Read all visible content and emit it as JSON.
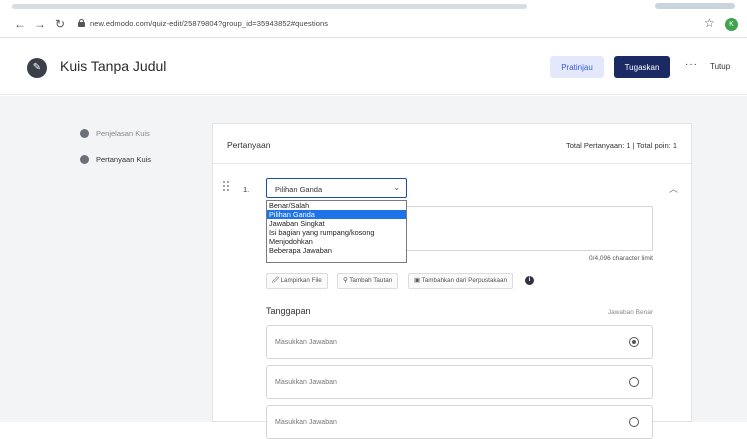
{
  "browser": {
    "back_icon": "back-arrow-icon",
    "forward_icon": "forward-arrow-icon",
    "reload_icon": "reload-icon",
    "url": "new.edmodo.com/quiz-edit/25879804?group_id=35943852#questions",
    "profile_initial": "K"
  },
  "header": {
    "title": "Kuis Tanpa Judul",
    "preview_label": "Pratinjau",
    "assign_label": "Tugaskan",
    "more_label": "···",
    "close_label": "Tutup"
  },
  "sidebar": {
    "items": [
      {
        "label": "Penjelasan Kuis"
      },
      {
        "label": "Pertanyaan Kuis"
      }
    ]
  },
  "panel": {
    "title": "Pertanyaan",
    "totals": "Total Pertanyaan: 1  |  Total poin: 1"
  },
  "question": {
    "number": "1.",
    "type_selected": "Pilihan Ganda",
    "type_options": [
      "Benar/Salah",
      "Pilihan Ganda",
      "Jawaban Singkat",
      "Isi bagian yang rumpang/kosong",
      "Menjodohkan",
      "Beberapa Jawaban"
    ],
    "char_limit": "0/4,096 character limit",
    "attach_file": "Lampirkan File",
    "add_link": "Tambah Tautan",
    "add_library": "Tambahkan dari Perpustakaan"
  },
  "responses": {
    "title": "Tanggapan",
    "correct_label": "Jawaban Benar",
    "answers": [
      {
        "placeholder": "Masukkan Jawaban",
        "correct": true
      },
      {
        "placeholder": "Masukkan Jawaban",
        "correct": false
      },
      {
        "placeholder": "Masukkan Jawaban",
        "correct": false
      }
    ]
  },
  "colors": {
    "primary": "#1b2a63",
    "preview_bg": "#e3e9fb",
    "dropdown_selected": "#1e73e8",
    "select_border": "#1a4fa8"
  }
}
